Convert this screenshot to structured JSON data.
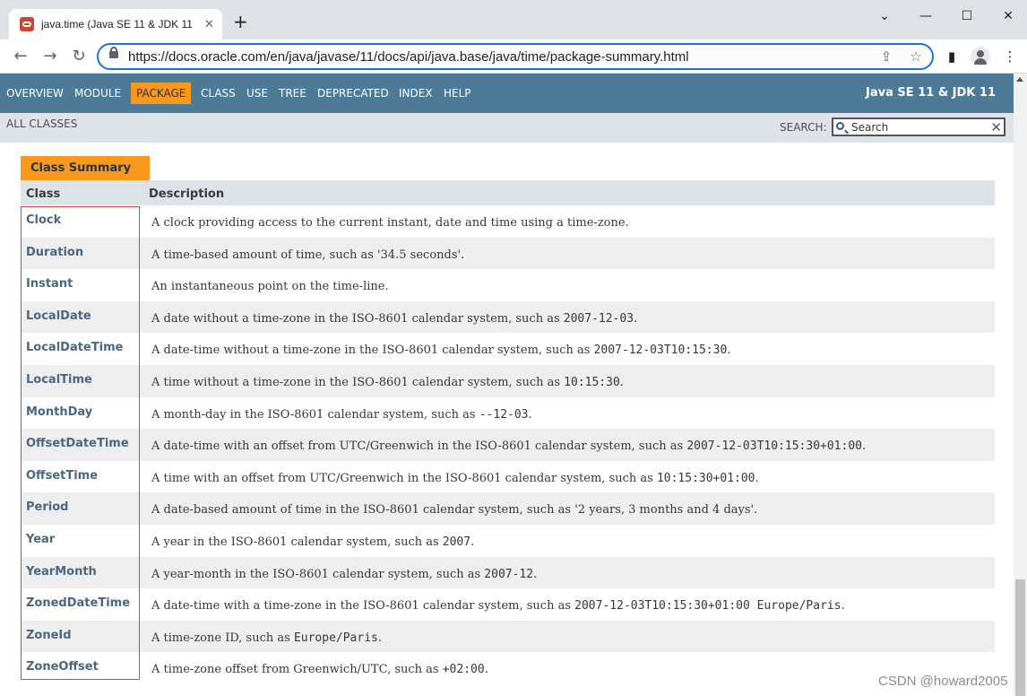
{
  "browser": {
    "tab_title": "java.time (Java SE 11 & JDK 11",
    "tab_close": "✕",
    "new_tab": "+",
    "url": "https://docs.oracle.com/en/java/javase/11/docs/api/java.base/java/time/package-summary.html",
    "window_buttons": [
      "⌄",
      "—",
      "☐",
      "✕"
    ],
    "nav_buttons": [
      "←",
      "→",
      "↻"
    ],
    "omnibox_icons": [
      "⇪",
      "☆"
    ],
    "toolbar_icons": [
      "▮",
      "⋮"
    ]
  },
  "page": {
    "nav_items": [
      "OVERVIEW",
      "MODULE",
      "PACKAGE",
      "CLASS",
      "USE",
      "TREE",
      "DEPRECATED",
      "INDEX",
      "HELP"
    ],
    "active_nav": "PACKAGE",
    "about_language": "Java SE 11 & JDK 11",
    "all_classes": "ALL CLASSES",
    "search_label": "SEARCH:",
    "search_placeholder": "Search",
    "search_reset": "✕",
    "table": {
      "caption": "Class Summary",
      "headers": [
        "Class",
        "Description"
      ],
      "rows": [
        {
          "class": "Clock",
          "description": "A clock providing access to the current instant, date and time using a time-zone."
        },
        {
          "class": "Duration",
          "description": "A time-based amount of time, such as '34.5 seconds'."
        },
        {
          "class": "Instant",
          "description": "An instantaneous point on the time-line."
        },
        {
          "class": "LocalDate",
          "description": "A date without a time-zone in the ISO-8601 calendar system, such as ",
          "code": "2007-12-03",
          "suffix": "."
        },
        {
          "class": "LocalDateTime",
          "description": "A date-time without a time-zone in the ISO-8601 calendar system, such as ",
          "code": "2007-12-03T10:15:30",
          "suffix": "."
        },
        {
          "class": "LocalTime",
          "description": "A time without a time-zone in the ISO-8601 calendar system, such as ",
          "code": "10:15:30",
          "suffix": "."
        },
        {
          "class": "MonthDay",
          "description": "A month-day in the ISO-8601 calendar system, such as ",
          "code": "--12-03",
          "suffix": "."
        },
        {
          "class": "OffsetDateTime",
          "description": "A date-time with an offset from UTC/Greenwich in the ISO-8601 calendar system, such as ",
          "code": "2007-12-03T10:15:30+01:00",
          "suffix": "."
        },
        {
          "class": "OffsetTime",
          "description": "A time with an offset from UTC/Greenwich in the ISO-8601 calendar system, such as ",
          "code": "10:15:30+01:00",
          "suffix": "."
        },
        {
          "class": "Period",
          "description": "A date-based amount of time in the ISO-8601 calendar system, such as '2 years, 3 months and 4 days'."
        },
        {
          "class": "Year",
          "description": "A year in the ISO-8601 calendar system, such as ",
          "code": "2007",
          "suffix": "."
        },
        {
          "class": "YearMonth",
          "description": "A year-month in the ISO-8601 calendar system, such as ",
          "code": "2007-12",
          "suffix": "."
        },
        {
          "class": "ZonedDateTime",
          "description": "A date-time with a time-zone in the ISO-8601 calendar system, such as ",
          "code": "2007-12-03T10:15:30+01:00 Europe/Paris",
          "suffix": "."
        },
        {
          "class": "ZoneId",
          "description": "A time-zone ID, such as ",
          "code": "Europe/Paris",
          "suffix": "."
        },
        {
          "class": "ZoneOffset",
          "description": "A time-zone offset from Greenwich/UTC, such as ",
          "code": "+02:00",
          "suffix": "."
        }
      ]
    }
  },
  "watermark": "CSDN @howard2005",
  "colors": {
    "nav_bg": "#4d7a97",
    "active_tab": "#f8981d",
    "subnav_bg": "#dee3e9",
    "link": "#4a6782",
    "highlight": "#e04040"
  }
}
